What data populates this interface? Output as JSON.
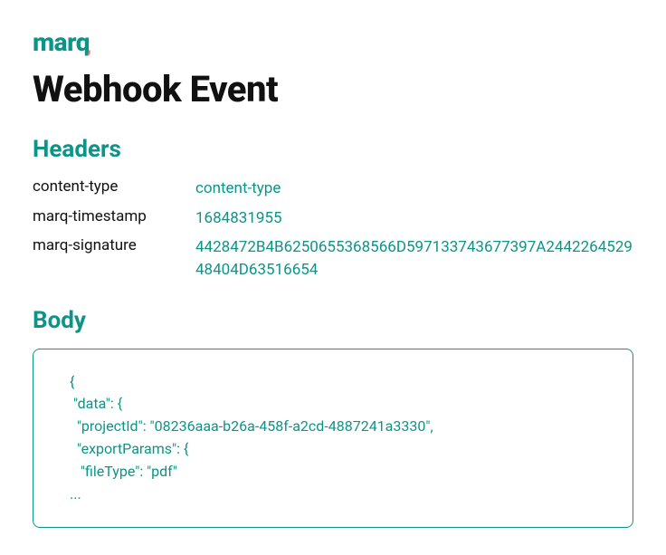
{
  "brand": {
    "name": "marq"
  },
  "title": "Webhook Event",
  "sections": {
    "headers": {
      "title": "Headers",
      "rows": [
        {
          "key": "content-type",
          "value": "content-type"
        },
        {
          "key": "marq-timestamp",
          "value": "1684831955"
        },
        {
          "key": "marq-signature",
          "value": "4428472B4B6250655368566D597133743677397A244226452948404D63516654"
        }
      ]
    },
    "body": {
      "title": "Body",
      "code": "{\n \"data\": {\n  \"projectId\": \"08236aaa-b26a-458f-a2cd-4887241a3330\",\n  \"exportParams\": {\n   \"fileType\": \"pdf\"\n...                                      "
    }
  }
}
